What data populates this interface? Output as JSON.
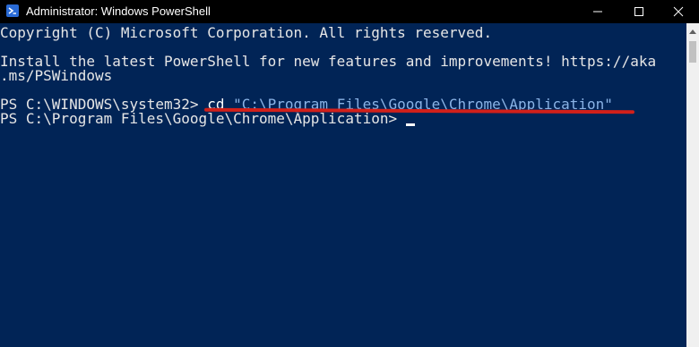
{
  "titlebar": {
    "title": "Administrator: Windows PowerShell",
    "app_icon": "powershell-icon",
    "buttons": [
      "minimize-icon",
      "maximize-icon",
      "close-icon"
    ]
  },
  "console": {
    "copyright": "Copyright (C) Microsoft Corporation. All rights reserved.",
    "install_line1": "Install the latest PowerShell for new features and improvements! https://aka",
    "install_line2": ".ms/PSWindows",
    "prompt1": "PS C:\\WINDOWS\\system32> ",
    "command": "cd",
    "argument": "\"C:\\Program Files\\Google\\Chrome\\Application\"",
    "prompt2": "PS C:\\Program Files\\Google\\Chrome\\Application> "
  },
  "colors": {
    "background": "#012456",
    "titlebar": "#000000",
    "text": "#e6e6e6",
    "argument": "#8ab3e6",
    "annotation": "#d2201a"
  }
}
